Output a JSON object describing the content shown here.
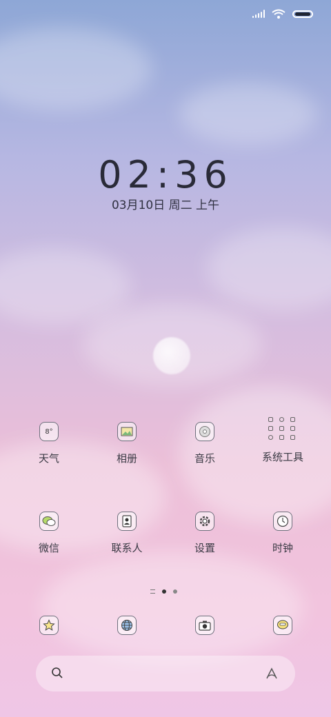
{
  "status": {
    "icons": [
      "signal-icon",
      "wifi-icon",
      "battery-icon"
    ]
  },
  "clock": {
    "time": "02:36",
    "date": "03月10日 周二 上午"
  },
  "apps": [
    {
      "label": "天气",
      "icon": "weather-icon",
      "temp": "8°"
    },
    {
      "label": "相册",
      "icon": "gallery-icon"
    },
    {
      "label": "音乐",
      "icon": "music-icon"
    },
    {
      "label": "系统工具",
      "icon": "folder-icon"
    },
    {
      "label": "微信",
      "icon": "wechat-icon"
    },
    {
      "label": "联系人",
      "icon": "contacts-icon"
    },
    {
      "label": "设置",
      "icon": "settings-icon"
    },
    {
      "label": "时钟",
      "icon": "clock-icon"
    }
  ],
  "page_indicator": {
    "pages": 2,
    "current": 1
  },
  "dock": [
    "favorites-icon",
    "browser-icon",
    "camera-icon",
    "messages-icon"
  ],
  "search": {
    "icons": [
      "search-icon",
      "assistant-icon"
    ]
  },
  "colors": {
    "accent": "#2a2b38",
    "bg_top": "#8ea7d6",
    "bg_bottom": "#efc6e6"
  }
}
